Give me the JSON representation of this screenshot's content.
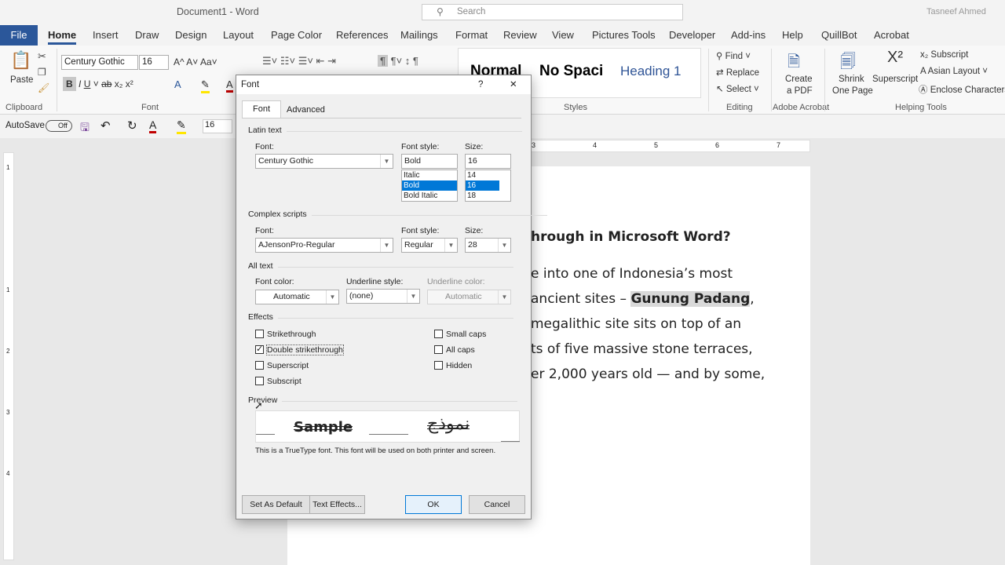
{
  "window": {
    "title": "Document1  -  Word",
    "search_placeholder": "Search",
    "user": "Tasneef Ahmed"
  },
  "tabs": [
    "File",
    "Home",
    "Insert",
    "Draw",
    "Design",
    "Layout",
    "Page Color",
    "References",
    "Mailings",
    "Format",
    "Review",
    "View",
    "Pictures Tools",
    "Developer",
    "Add-ins",
    "Help",
    "QuillBot",
    "Acrobat"
  ],
  "ribbon": {
    "paste": "Paste",
    "clipboard": "Clipboard",
    "font_name": "Century Gothic",
    "font_size": "16",
    "font_group": "Font",
    "styles": [
      "Normal",
      "No Spaci",
      "Heading 1"
    ],
    "styles_group": "Styles",
    "find": "Find",
    "replace": "Replace",
    "select": "Select",
    "editing": "Editing",
    "create_pdf_1": "Create",
    "create_pdf_2": "a PDF",
    "adobe": "Adobe Acrobat",
    "shrink_1": "Shrink",
    "shrink_2": "One Page",
    "superscript": "Superscript",
    "subscript": "Subscript",
    "asian_layout": "Asian Layout",
    "enclose": "Enclose Characters",
    "helping": "Helping Tools"
  },
  "qat": {
    "autosave": "AutoSave",
    "toggle": "Off",
    "size": "16"
  },
  "ruler": [
    "3",
    "4",
    "5",
    "6",
    "7"
  ],
  "vruler": [
    "1",
    "1",
    "2",
    "3",
    "4"
  ],
  "doc": {
    "heading": "hrough in Microsoft Word?",
    "l1": "e into one of Indonesia’s most",
    "l2a": "ancient sites – ",
    "l2b": "Gunung Padang",
    "l3": "megalithic site sits on top of an",
    "l4": "ts of five massive stone terraces,",
    "l5": "er 2,000 years old — and by some,"
  },
  "dialog": {
    "title": "Font",
    "help": "?",
    "close": "✕",
    "tab_font": "Font",
    "tab_advanced": "Advanced",
    "latin": "Latin text",
    "font_label": "Font:",
    "style_label": "Font style:",
    "size_label": "Size:",
    "latin_font": "Century Gothic",
    "latin_style": "Bold",
    "latin_size": "16",
    "style_list": [
      "Italic",
      "Bold",
      "Bold Italic"
    ],
    "size_list": [
      "14",
      "16",
      "18"
    ],
    "complex": "Complex scripts",
    "complex_font": "AJensonPro-Regular",
    "complex_style": "Regular",
    "complex_size": "28",
    "all_text": "All text",
    "color_label": "Font color:",
    "underline_label": "Underline style:",
    "ucolor_label": "Underline color:",
    "color_val": "Automatic",
    "underline_val": "(none)",
    "ucolor_val": "Automatic",
    "effects": "Effects",
    "strikethrough": "Strikethrough",
    "double_strike": "Double strikethrough",
    "superscript": "Superscript",
    "subscript": "Subscript",
    "small_caps": "Small caps",
    "all_caps": "All caps",
    "hidden": "Hidden",
    "preview": "Preview",
    "sample": "Sample",
    "arabic": "نموذج",
    "truetype": "This is a TrueType font. This font will be used on both printer and screen.",
    "set_default": "Set As Default",
    "text_effects": "Text Effects...",
    "ok": "OK",
    "cancel": "Cancel"
  }
}
